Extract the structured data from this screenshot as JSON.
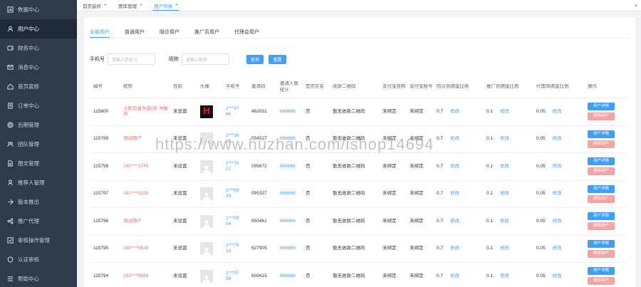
{
  "sidebar": {
    "items": [
      {
        "label": "数据中心",
        "icon": "chart-icon",
        "active": false
      },
      {
        "label": "用户中心",
        "icon": "user-icon",
        "active": true
      },
      {
        "label": "财务中心",
        "icon": "wallet-icon",
        "active": false
      },
      {
        "label": "消息中心",
        "icon": "message-icon",
        "active": false
      },
      {
        "label": "首页装修",
        "icon": "home-icon",
        "active": false
      },
      {
        "label": "订单中心",
        "icon": "order-icon",
        "active": false
      },
      {
        "label": "后期管理",
        "icon": "settings-icon",
        "active": false
      },
      {
        "label": "团队管理",
        "icon": "team-icon",
        "active": false
      },
      {
        "label": "图文管理",
        "icon": "doc-icon",
        "active": false
      },
      {
        "label": "推荐人管理",
        "icon": "referral-icon",
        "active": false
      },
      {
        "label": "版本推出",
        "icon": "version-icon",
        "active": false
      },
      {
        "label": "推广代理",
        "icon": "share-icon",
        "active": false
      },
      {
        "label": "审核操作管理",
        "icon": "audit-icon",
        "active": false
      },
      {
        "label": "认证审核",
        "icon": "verify-icon",
        "active": false
      },
      {
        "label": "帮助中心",
        "icon": "help-icon",
        "active": false
      }
    ]
  },
  "tabs": [
    {
      "label": "首页装修",
      "active": false
    },
    {
      "label": "图库管理",
      "active": false
    },
    {
      "label": "用户列表",
      "active": true
    }
  ],
  "subtabs": [
    "全部用户",
    "普通用户",
    "陪诊用户",
    "推广员用户",
    "代理会用户"
  ],
  "filters": {
    "phone_label": "手机号",
    "phone_placeholder": "请输入手机号",
    "nick_label": "昵称",
    "nick_placeholder": "请输入昵称",
    "query_label": "查询",
    "reset_label": "重置"
  },
  "columns": [
    "编号",
    "昵称",
    "性别",
    "头像",
    "手机号",
    "邀请码",
    "邀请人数统计",
    "是否实名",
    "收款二维码",
    "支付宝名称",
    "支付宝账号",
    "陪诊员佣金比例",
    "推广员佣金比例",
    "代理商佣金比例",
    "操作"
  ],
  "rows": [
    {
      "id": "115800",
      "nick": "火影忍者手游(穿·冲破界",
      "gender": "未设置",
      "avatar": "image",
      "phone": "1***97 \n66",
      "code": "462031",
      "invites": "666666",
      "realname": "否",
      "qr": "暂无收款二维码",
      "alipay_name": "未绑定",
      "alipay_acct": "未绑定",
      "r1": "0.7",
      "r2": "0.1",
      "r3": "0.05"
    },
    {
      "id": "115799",
      "nick": "测试用户",
      "gender": "未设置",
      "avatar": "default",
      "phone": "1***16 \n56",
      "code": "054527",
      "invites": "666666",
      "realname": "否",
      "qr": "暂无收款二维码",
      "alipay_name": "未绑定",
      "alipay_acct": "未绑定",
      "r1": "0.7",
      "r2": "0.1",
      "r3": "0.05"
    },
    {
      "id": "115798",
      "nick": "180****3745",
      "gender": "未设置",
      "avatar": "default",
      "phone": "1***70 \n07",
      "code": "095672",
      "invites": "666666",
      "realname": "否",
      "qr": "暂无收款二维码",
      "alipay_name": "未绑定",
      "alipay_acct": "未绑定",
      "r1": "0.7",
      "r2": "0.1",
      "r3": "0.05"
    },
    {
      "id": "115797",
      "nick": "181****9339",
      "gender": "未设置",
      "avatar": "default",
      "phone": "1***99 \n39",
      "code": "095327",
      "invites": "666666",
      "realname": "否",
      "qr": "暂无收款二维码",
      "alipay_name": "未绑定",
      "alipay_acct": "未绑定",
      "r1": "0.7",
      "r2": "0.1",
      "r3": "0.05"
    },
    {
      "id": "115796",
      "nick": "测试用户",
      "gender": "未设置",
      "avatar": "default",
      "phone": "1***00 \n04",
      "code": "850461",
      "invites": "666666",
      "realname": "否",
      "qr": "暂无收款二维码",
      "alipay_name": "未绑定",
      "alipay_acct": "未绑定",
      "r1": "0.7",
      "r2": "0.1",
      "r3": "0.05"
    },
    {
      "id": "115795",
      "nick": "180****5618",
      "gender": "未设置",
      "avatar": "default",
      "phone": "1***76 \n18",
      "code": "627905",
      "invites": "666666",
      "realname": "否",
      "qr": "暂无收款二维码",
      "alipay_name": "未绑定",
      "alipay_acct": "未绑定",
      "r1": "0.7",
      "r2": "0.1",
      "r3": "0.05"
    },
    {
      "id": "115794",
      "nick": "183****9549",
      "gender": "未设置",
      "avatar": "default",
      "phone": "1***07 \n56",
      "code": "609415",
      "invites": "666666",
      "realname": "否",
      "qr": "暂无收款二维码",
      "alipay_name": "未绑定",
      "alipay_acct": "未绑定",
      "r1": "0.7",
      "r2": "0.1",
      "r3": "0.05"
    }
  ],
  "row_actions": {
    "detail": "用户详情",
    "delete": "删除用户",
    "edit": "修改"
  },
  "watermark": "https://www.huzhan.com/ishop14694",
  "colors": {
    "accent": "#409eff",
    "sidebar_bg": "#2f3a4b",
    "danger": "#f56c6c"
  }
}
